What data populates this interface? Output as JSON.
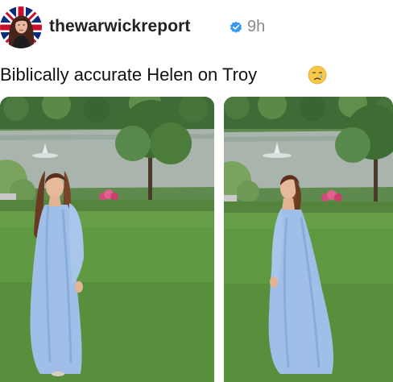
{
  "post": {
    "username": "thewarwickreport",
    "time_ago": "9h",
    "caption": "Biblically accurate Helen on Troy",
    "caption_emoji": "crying-face-emoji",
    "verified_icon": "verified-badge-icon",
    "accent_color": "#3897f0"
  },
  "media": {
    "count": 2,
    "alt": [
      "photo-1",
      "photo-2"
    ]
  }
}
